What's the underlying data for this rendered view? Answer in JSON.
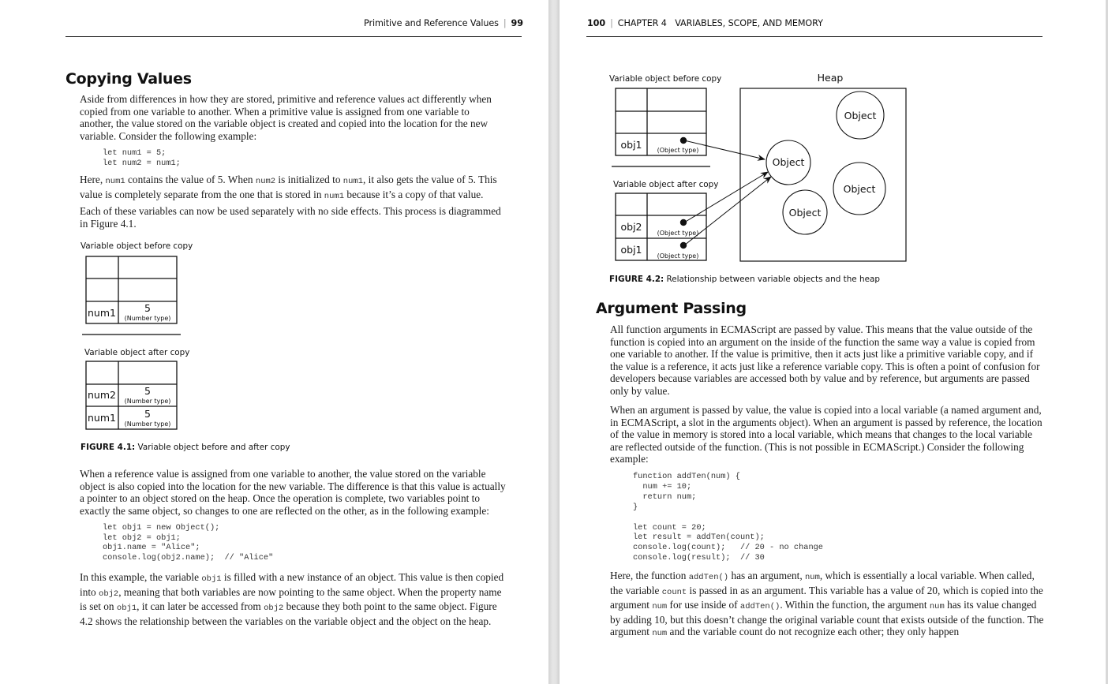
{
  "left_page": {
    "header": {
      "title": "Primitive and Reference Values",
      "page_number": "99"
    },
    "section_title": "Copying Values",
    "paragraphs": {
      "p1": "Aside from differences in how they are stored, primitive and reference values act differently when copied from one variable to another. When a primitive value is assigned from one variable to another, the value stored on the variable object is created and copied into the location for the new variable. Consider the following example:",
      "p2_parts": [
        "Here, ",
        "num1",
        " contains the value of 5. When ",
        "num2",
        " is initialized to ",
        "num1",
        ", it also gets the value of 5. This value is completely separate from the one that is stored in ",
        "num1",
        " because it’s a copy of that value."
      ],
      "p3": "Each of these variables can now be used separately with no side effects. This process is diagrammed in Figure 4.1.",
      "p4": "When a reference value is assigned from one variable to another, the value stored on the variable object is also copied into the location for the new variable. The difference is that this value is actually a pointer to an object stored on the heap. Once the operation is complete, two variables point to exactly the same object, so changes to one are reflected on the other, as in the following example:",
      "p5_parts": [
        "In this example, the variable ",
        "obj1",
        " is filled with a new instance of an object. This value is then copied into ",
        "obj2",
        ", meaning that both variables are now pointing to the same object. When the property name is set on ",
        "obj1",
        ", it can later be accessed from ",
        "obj2",
        " because they both point to the same object. Figure 4.2 shows the relationship between the variables on the variable object and the object on the heap."
      ]
    },
    "code1": [
      "let num1 = 5;",
      "let num2 = num1;"
    ],
    "code2": [
      "let obj1 = new Object();",
      "let obj2 = obj1;",
      "obj1.name = \"Alice\";",
      "console.log(obj2.name);  // \"Alice\""
    ],
    "figure": {
      "before_label": "Variable object before copy",
      "after_label": "Variable object after copy",
      "before_rows": [
        {
          "name": "",
          "value": "",
          "type": ""
        },
        {
          "name": "",
          "value": "",
          "type": ""
        },
        {
          "name": "num1",
          "value": "5",
          "type": "(Number type)"
        }
      ],
      "after_rows": [
        {
          "name": "",
          "value": "",
          "type": ""
        },
        {
          "name": "num2",
          "value": "5",
          "type": "(Number type)"
        },
        {
          "name": "num1",
          "value": "5",
          "type": "(Number type)"
        }
      ],
      "caption_label": "FIGURE 4.1:",
      "caption_text": " Variable object before and after copy"
    }
  },
  "right_page": {
    "header": {
      "page_number": "100",
      "chapter": "CHAPTER 4",
      "chapter_title": "VARIABLES, SCOPE, AND MEMORY"
    },
    "figure": {
      "before_label": "Variable object before copy",
      "after_label": "Variable object after copy",
      "heap_label": "Heap",
      "before_rows": [
        {
          "name": "",
          "type": ""
        },
        {
          "name": "",
          "type": ""
        },
        {
          "name": "obj1",
          "type": "(Object type)"
        }
      ],
      "after_rows": [
        {
          "name": "",
          "type": ""
        },
        {
          "name": "obj2",
          "type": "(Object type)"
        },
        {
          "name": "obj1",
          "type": "(Object type)"
        }
      ],
      "heap_objects": [
        "Object",
        "Object",
        "Object",
        "Object"
      ],
      "caption_label": "FIGURE 4.2:",
      "caption_text": " Relationship between variable objects and the heap"
    },
    "section_title": "Argument Passing",
    "paragraphs": {
      "p1": "All function arguments in ECMAScript are passed by value. This means that the value outside of the function is copied into an argument on the inside of the function the same way a value is copied from one variable to another. If the value is primitive, then it acts just like a primitive variable copy, and if the value is a reference, it acts just like a reference variable copy. This is often a point of confusion for developers because variables are accessed both by value and by reference, but arguments are passed only by value.",
      "p2": "When an argument is passed by value, the value is copied into a local variable (a named argument and, in ECMAScript, a slot in the arguments object). When an argument is passed by reference, the location of the value in memory is stored into a local variable, which means that changes to the local variable are reflected outside of the function. (This is not possible in ECMAScript.) Consider the following example:",
      "p3_parts": [
        "Here, the function ",
        "addTen()",
        " has an argument, ",
        "num",
        ", which is essentially a local variable. When called, the variable ",
        "count",
        " is passed in as an argument. This variable has a value of 20, which is copied into the argument ",
        "num",
        " for use inside of ",
        "addTen()",
        ". Within the function, the argument ",
        "num",
        " has its value changed by adding 10, but this doesn’t change the original variable count that exists outside of the function. The argument ",
        "num",
        " and the variable count do not recognize each other; they only happen"
      ]
    },
    "code": [
      "function addTen(num) {",
      "  num += 10;",
      "  return num;",
      "}",
      "",
      "let count = 20;",
      "let result = addTen(count);",
      "console.log(count);   // 20 - no change",
      "console.log(result);  // 30"
    ]
  }
}
